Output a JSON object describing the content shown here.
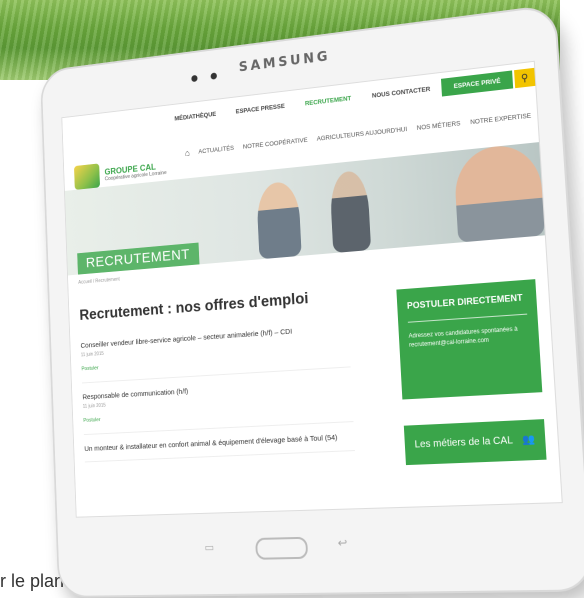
{
  "page": {
    "under_text": "r le plan"
  },
  "device": {
    "brand": "SAMSUNG"
  },
  "topbar": {
    "links": [
      "MÉDIATHÈQUE",
      "ESPACE PRESSE",
      "RECRUTEMENT",
      "NOUS CONTACTER"
    ],
    "espace_prive": "ESPACE PRIVÉ",
    "search_icon": "magnifier"
  },
  "logo": {
    "name": "GROUPE CAL",
    "subtitle": "Coopérative agricole Lorraine"
  },
  "mainnav": {
    "items": [
      "ACTUALITÉS",
      "NOTRE COOPÉRATIVE",
      "AGRICULTEURS AUJOURD'HUI",
      "NOS MÉTIERS",
      "NOTRE EXPERTISE"
    ]
  },
  "banner": {
    "title": "RECRUTEMENT"
  },
  "breadcrumb": "Accueil / Recrutement",
  "main": {
    "title": "Recrutement : nos offres d'emploi",
    "jobs": [
      {
        "title": "Conseiller vendeur libre-service agricole – secteur animalerie (h/f) – CDI",
        "date": "11 juin 2015",
        "link": "Postuler"
      },
      {
        "title": "Responsable de communication (h/f)",
        "date": "11 juin 2015",
        "link": "Postuler"
      },
      {
        "title": "Un monteur & installateur en confort animal & équipement d'élevage basé à Toul (54)",
        "date": "",
        "link": ""
      }
    ]
  },
  "sidebar": {
    "postuler_title": "POSTULER DIRECTEMENT",
    "postuler_text": "Adressez vos candidatures spontanées à recrutement@cal-lorraine.com",
    "metiers_label": "Les métiers de la CAL",
    "metiers_icon": "people-icon"
  },
  "colors": {
    "brand_green": "#3aa54a",
    "accent_yellow": "#f2c400"
  }
}
